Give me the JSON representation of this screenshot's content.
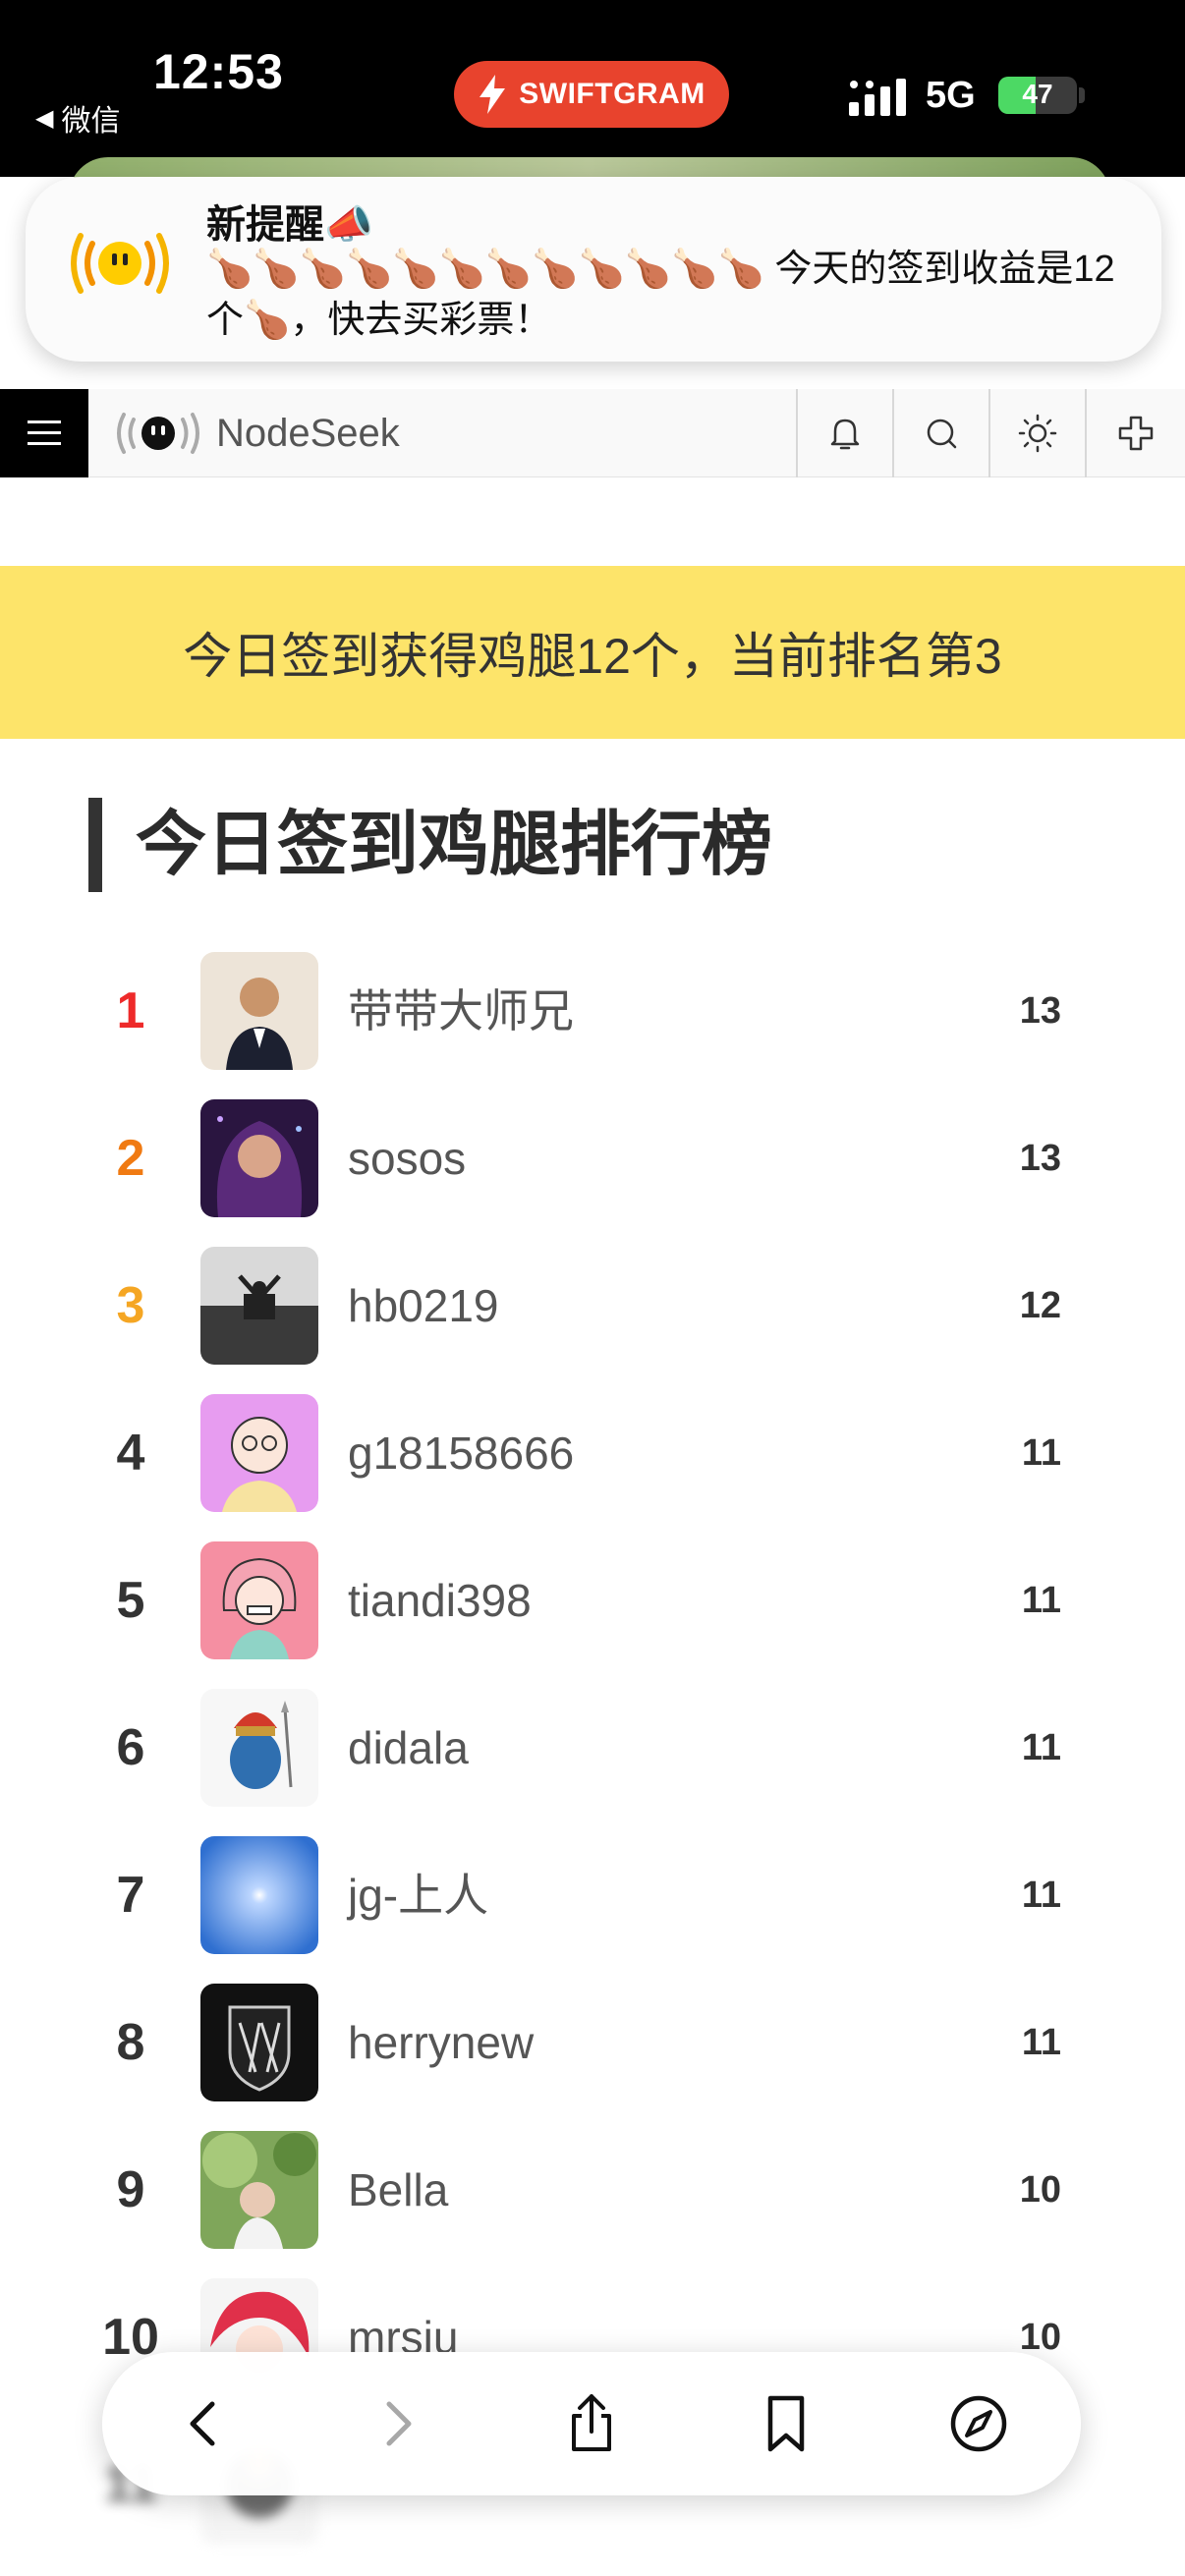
{
  "status_bar": {
    "time": "12:53",
    "back_app": "微信",
    "pill_label": "SWIFTGRAM",
    "network": "5G",
    "battery": "47",
    "battery_level": 0.47
  },
  "notification": {
    "title": "新提醒📣",
    "body": "🍗🍗🍗🍗🍗🍗🍗🍗🍗🍗🍗🍗 今天的签到收益是12个🍗，快去买彩票！"
  },
  "navbar": {
    "site_name": "NodeSeek"
  },
  "notice": {
    "text": "今日签到获得鸡腿12个，当前排名第3"
  },
  "board": {
    "title": "今日签到鸡腿排行榜",
    "rows": [
      {
        "rank": "1",
        "name": "带带大师兄",
        "score": "13"
      },
      {
        "rank": "2",
        "name": "sosos",
        "score": "13"
      },
      {
        "rank": "3",
        "name": "hb0219",
        "score": "12"
      },
      {
        "rank": "4",
        "name": "g18158666",
        "score": "11"
      },
      {
        "rank": "5",
        "name": "tiandi398",
        "score": "11"
      },
      {
        "rank": "6",
        "name": "didala",
        "score": "11"
      },
      {
        "rank": "7",
        "name": "jg-上人",
        "score": "11"
      },
      {
        "rank": "8",
        "name": "herrynew",
        "score": "11"
      },
      {
        "rank": "9",
        "name": "Bella",
        "score": "10"
      },
      {
        "rank": "10",
        "name": "mrsiu",
        "score": "10"
      },
      {
        "rank": "11",
        "name": "",
        "score": ""
      }
    ]
  },
  "colors": {
    "rank1": "#ee2a2a",
    "rank2": "#f07a12",
    "rank3": "#f5a623",
    "notice_bg": "#fde46a",
    "swiftgram": "#e8432d"
  },
  "toolbar": {
    "icons": [
      "chevron-left-icon",
      "chevron-right-icon",
      "share-icon",
      "bookmarks-icon",
      "compass-icon"
    ]
  }
}
